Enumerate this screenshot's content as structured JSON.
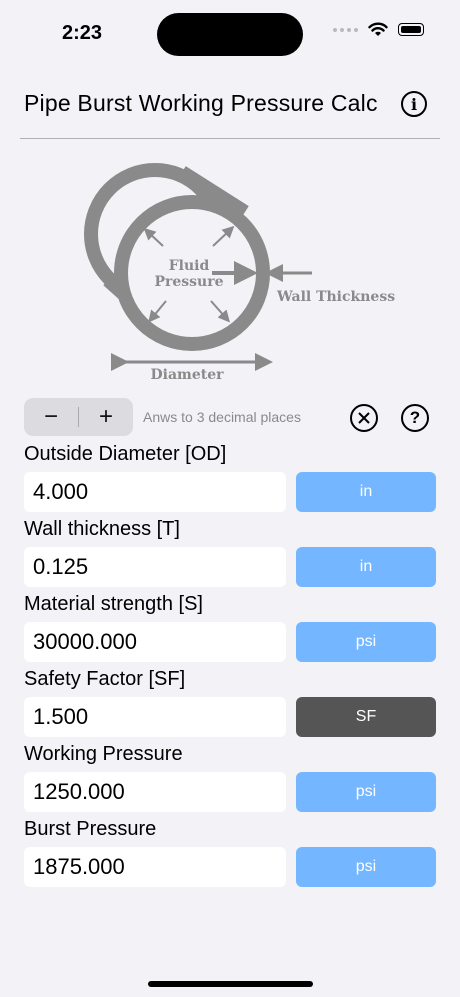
{
  "status": {
    "time": "2:23"
  },
  "header": {
    "title": "Pipe Burst Working Pressure Calc",
    "info_icon": "info-icon"
  },
  "diagram": {
    "fluid_label_1": "Fluid",
    "fluid_label_2": "Pressure",
    "wall_label": "Wall Thickness",
    "diameter_label": "Diameter",
    "color": "#8a8a8a"
  },
  "controls": {
    "minus": "−",
    "plus": "+",
    "precision_text": "Anws to 3 decimal places",
    "clear_icon": "⊗",
    "help_icon": "?"
  },
  "fields": [
    {
      "label": "Outside Diameter [OD]",
      "value": "4.000",
      "unit": "in"
    },
    {
      "label": "Wall thickness [T]",
      "value": "0.125",
      "unit": "in"
    },
    {
      "label": "Material strength [S]",
      "value": "30000.000",
      "unit": "psi"
    },
    {
      "label": "Safety Factor [SF]",
      "value": "1.500",
      "unit": "SF"
    },
    {
      "label": "Working Pressure",
      "value": "1250.000",
      "unit": "psi"
    },
    {
      "label": "Burst Pressure",
      "value": "1875.000",
      "unit": "psi"
    }
  ],
  "colors": {
    "accent": "#74b6ff",
    "dark_button": "#555555",
    "background": "#f2f2f7"
  }
}
